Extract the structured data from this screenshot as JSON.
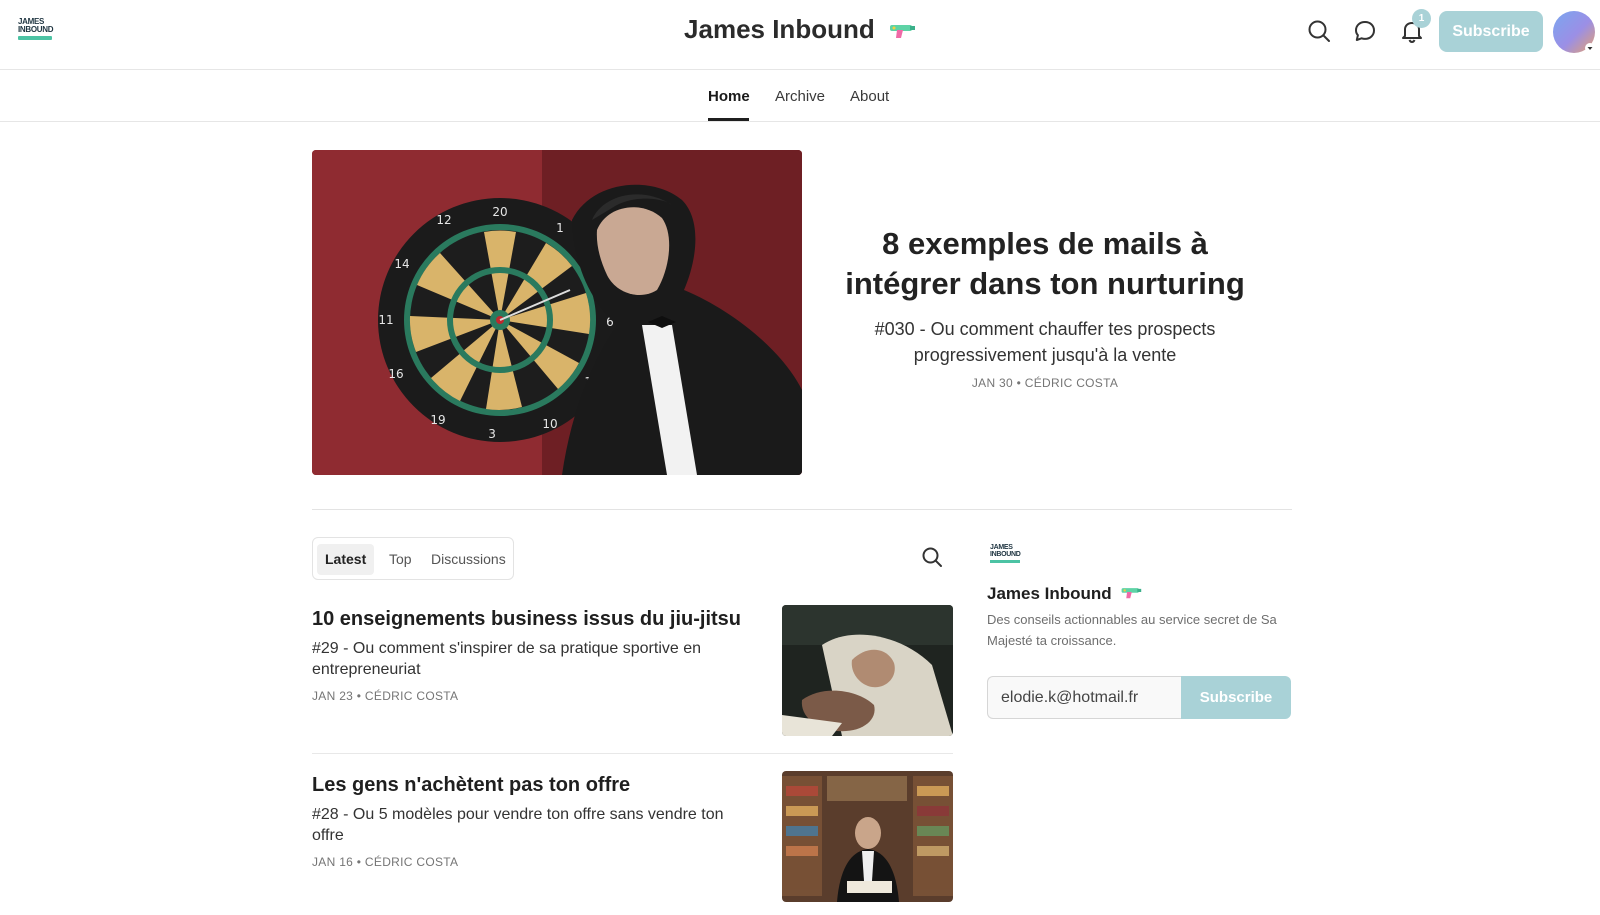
{
  "header": {
    "logo_line1": "JAMES",
    "logo_line2": "INBOUND",
    "title": "James Inbound",
    "notification_count": "1",
    "subscribe_label": "Subscribe",
    "icons": [
      "search-icon",
      "chat-icon",
      "bell-icon",
      "water-gun-icon"
    ]
  },
  "nav": {
    "tabs": [
      {
        "label": "Home",
        "active": true
      },
      {
        "label": "Archive",
        "active": false
      },
      {
        "label": "About",
        "active": false
      }
    ]
  },
  "featured": {
    "title": "8 exemples de mails à intégrer dans ton nurturing",
    "subtitle": "#030 - Ou comment chauffer tes prospects progressivement jusqu'à la vente",
    "meta": "JAN 30 • CÉDRIC COSTA"
  },
  "feed": {
    "tabs": [
      {
        "label": "Latest",
        "active": true
      },
      {
        "label": "Top",
        "active": false
      },
      {
        "label": "Discussions",
        "active": false
      }
    ],
    "posts": [
      {
        "title": "10 enseignements business issus du jiu-jitsu",
        "subtitle": "#29 - Ou comment s'inspirer de sa pratique sportive en entrepreneuriat",
        "meta": "JAN 23 • CÉDRIC COSTA"
      },
      {
        "title": "Les gens n'achètent pas ton offre",
        "subtitle": "#28 - Ou 5 modèles pour vendre ton offre sans vendre ton offre",
        "meta": "JAN 16 • CÉDRIC COSTA"
      }
    ]
  },
  "sidebar": {
    "title": "James Inbound",
    "description": "Des conseils actionnables au service secret de Sa Majesté ta croissance.",
    "email_value": "elodie.k@hotmail.fr",
    "subscribe_label": "Subscribe"
  },
  "colors": {
    "accent": "#a9d2d7",
    "hero_background": "#8a2a2f",
    "logo_bar": "#4cc3a4"
  }
}
